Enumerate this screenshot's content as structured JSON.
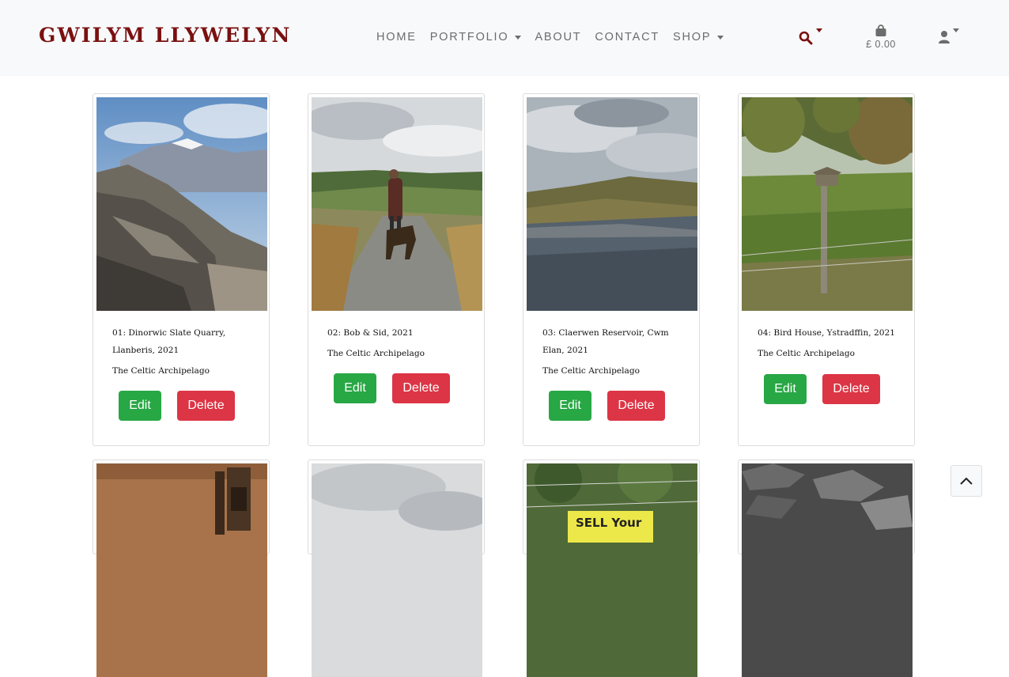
{
  "brand": "GWILYM LLYWELYN",
  "nav": [
    {
      "label": "HOME",
      "dropdown": false
    },
    {
      "label": "PORTFOLIO",
      "dropdown": true
    },
    {
      "label": "ABOUT",
      "dropdown": false
    },
    {
      "label": "CONTACT",
      "dropdown": false
    },
    {
      "label": "SHOP",
      "dropdown": true
    }
  ],
  "bag_total": "£ 0.00",
  "icons": {
    "search": "search-icon",
    "bag": "shopping-bag-icon",
    "account": "user-icon",
    "scroll_top": "chevron-up-icon"
  },
  "colors": {
    "brand": "#7a1010",
    "edit": "#28a745",
    "delete": "#dc3545",
    "nav_text": "#6c6c6c"
  },
  "products": [
    {
      "title": "01: Dinorwic Slate Quarry, Llanberis, 2021",
      "collection": "The Celtic Archipelago",
      "edit_label": "Edit",
      "delete_label": "Delete"
    },
    {
      "title": "02: Bob & Sid, 2021",
      "collection": "The Celtic Archipelago",
      "edit_label": "Edit",
      "delete_label": "Delete"
    },
    {
      "title": "03: Claerwen Reservoir, Cwm Elan, 2021",
      "collection": "The Celtic Archipelago",
      "edit_label": "Edit",
      "delete_label": "Delete"
    },
    {
      "title": "04: Bird House, Ystradffin, 2021",
      "collection": "The Celtic Archipelago",
      "edit_label": "Edit",
      "delete_label": "Delete"
    }
  ],
  "sign_text": "SELL Your"
}
